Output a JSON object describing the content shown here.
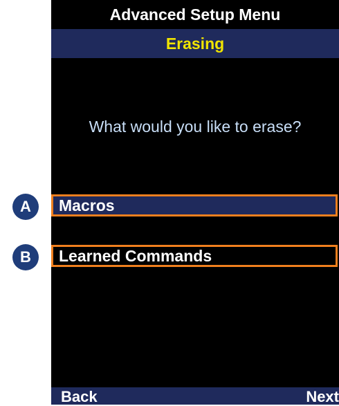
{
  "header": {
    "title": "Advanced Setup Menu",
    "subtitle": "Erasing"
  },
  "prompt": "What would you like to erase?",
  "options": [
    {
      "badge": "A",
      "label": "Macros",
      "selected": true
    },
    {
      "badge": "B",
      "label": "Learned Commands",
      "selected": false
    }
  ],
  "softkeys": {
    "left": "Back",
    "right": "Next"
  },
  "colors": {
    "screen_bg": "#000000",
    "bar_navy": "#1f2a5c",
    "subtitle_yellow": "#f0e400",
    "prompt_blue": "#c8def7",
    "highlight_orange": "#f07f1e",
    "badge_blue": "#1f3d7a"
  }
}
